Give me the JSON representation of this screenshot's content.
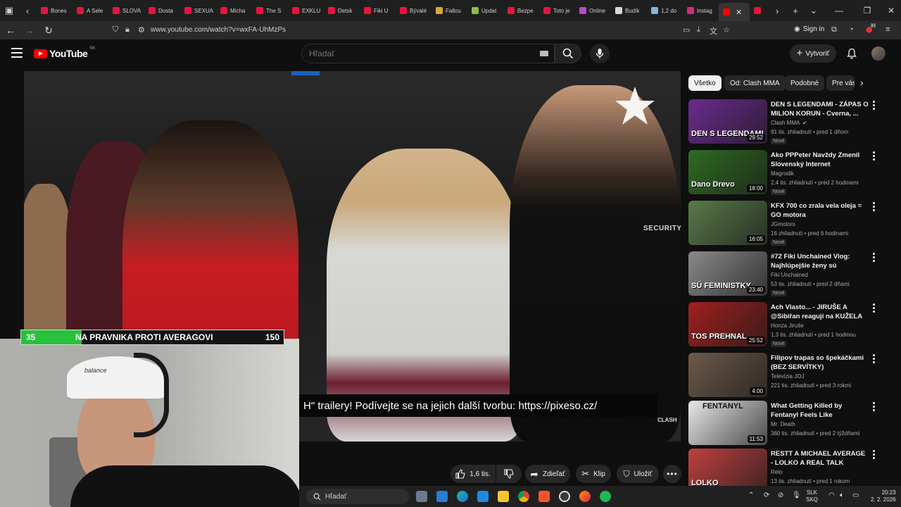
{
  "browser": {
    "tabs": [
      {
        "title": "Bones",
        "color": "#e6143c"
      },
      {
        "title": "A Sele",
        "color": "#e6143c"
      },
      {
        "title": "SLOVA",
        "color": "#e6143c"
      },
      {
        "title": "Dosta",
        "color": "#e6143c"
      },
      {
        "title": "SEXUA",
        "color": "#e6143c"
      },
      {
        "title": "Micha",
        "color": "#e6143c"
      },
      {
        "title": "The S",
        "color": "#e6143c"
      },
      {
        "title": "EXKLU",
        "color": "#e6143c"
      },
      {
        "title": "Detsk",
        "color": "#e6143c"
      },
      {
        "title": "Fiki U",
        "color": "#e6143c"
      },
      {
        "title": "Bývalé",
        "color": "#e6143c"
      },
      {
        "title": "Fallou",
        "color": "#d9a441"
      },
      {
        "title": "Updat",
        "color": "#8cbf4a"
      },
      {
        "title": "Bezpe",
        "color": "#e6143c"
      },
      {
        "title": "Toto je",
        "color": "#e6143c"
      },
      {
        "title": "Online",
        "color": "#b44cc8"
      },
      {
        "title": "Budík",
        "color": "#d8d8d8"
      },
      {
        "title": "1,2 do",
        "color": "#7fb7e0"
      },
      {
        "title": "Instag",
        "color": "#d62976"
      }
    ],
    "url": "www.youtube.com/watch?v=wxFA-UhMzPs",
    "signin_label": "Sign in",
    "ext_badge": "32"
  },
  "youtube": {
    "logo_text": "YouTube",
    "country_code": "SK",
    "search_placeholder": "Hľadať",
    "create_label": "Vytvoriť"
  },
  "video": {
    "caption": "H\" trailery! Podívejte se na jejich další tvorbu: https://pixeso.cz/",
    "watermark": "CLASH",
    "security_text": "SECURITY"
  },
  "overlay": {
    "score_left": "35",
    "score_text": "NA PRAVNIKA PROTI AVERAGOVI",
    "score_right": "150",
    "cap_text": "balance",
    "bar_color": "#27c23a",
    "bar_fraction": 0.23
  },
  "actions": {
    "like_count": "1,6 tis.",
    "share_label": "Zdieľať",
    "clip_label": "Klip",
    "save_label": "Uložiť"
  },
  "chips": [
    "Všetko",
    "Od: Clash MMA",
    "Podobné",
    "Pre vás"
  ],
  "recommendations": [
    {
      "title": "DEN S LEGENDAMI - ZÁPAS O MILION KORUN - Cverna, ...",
      "channel": "Clash MMA",
      "verified": true,
      "meta": "91 tis. zhliadnutí • pred 1 dňom",
      "badge": "Nové",
      "duration": "29:52",
      "thumb_text": "DEN S LEGENDAMI",
      "thumb_color": "#6b2b8f"
    },
    {
      "title": "Ako PPPeter Navždy Zmenil Slovenský Internet",
      "channel": "Magrodik",
      "verified": false,
      "meta": "2,4 tis. zhliadnutí • pred 2 hodinami",
      "badge": "Nové",
      "duration": "18:00",
      "thumb_text": "Dano Drevo",
      "thumb_color": "#2f6b22"
    },
    {
      "title": "KFX 700 co zrala vela oleja = GO motora",
      "channel": "JGmotors",
      "verified": false,
      "meta": "16 zhliadnutí • pred 6 hodinami",
      "badge": "Nové",
      "duration": "16:05",
      "thumb_text": "",
      "thumb_color": "#5a7a4a"
    },
    {
      "title": "#72 Fiki Unchained Vlog: Najhlúpejšie ženy sú feministky",
      "channel": "Fiki Unchained",
      "verified": false,
      "meta": "53 tis. zhliadnutí • pred 2 dňami",
      "badge": "Nové",
      "duration": "23:40",
      "thumb_text": "SÚ FEMINISTKY",
      "thumb_color": "#8a8a8a"
    },
    {
      "title": "Ach Vlasto... - JIRUŠE A @Sibiřan reagují na KUŽELA",
      "channel": "Honza Jiruše",
      "verified": false,
      "meta": "1,3 tis. zhliadnutí • pred 1 hodinou",
      "badge": "Nové",
      "duration": "25:52",
      "thumb_text": "TOS PREHNAL",
      "thumb_color": "#a0201e"
    },
    {
      "title": "Filipov trapas so špekáčkami (BEZ SERVÍTKY)",
      "channel": "Televízia JOJ",
      "verified": false,
      "meta": "221 tis. zhliadnutí • pred 3 rokmi",
      "badge": "",
      "duration": "4:00",
      "thumb_text": "",
      "thumb_color": "#6e5a4a"
    },
    {
      "title": "What Getting Killed by Fentanyl Feels Like",
      "channel": "Mr. Death",
      "verified": false,
      "meta": "360 tis. zhliadnutí • pred 2 týždňami",
      "badge": "",
      "duration": "11:53",
      "thumb_text": "FENTANYL",
      "thumb_color": "#e8e8e8"
    },
    {
      "title": "RESTT A MICHAEL AVERAGE - LOLKO A REAL TALK",
      "channel": "Relo",
      "verified": false,
      "meta": "13 tis. zhliadnutí • pred 1 rokom",
      "badge": "",
      "duration": "",
      "thumb_text": "LOLKO",
      "thumb_color": "#c04040"
    }
  ],
  "taskbar": {
    "search_label": "Hľadať",
    "lang_top": "SLK",
    "lang_bottom": "SKQ",
    "time": "20:23",
    "date": "2. 2. 2026"
  }
}
